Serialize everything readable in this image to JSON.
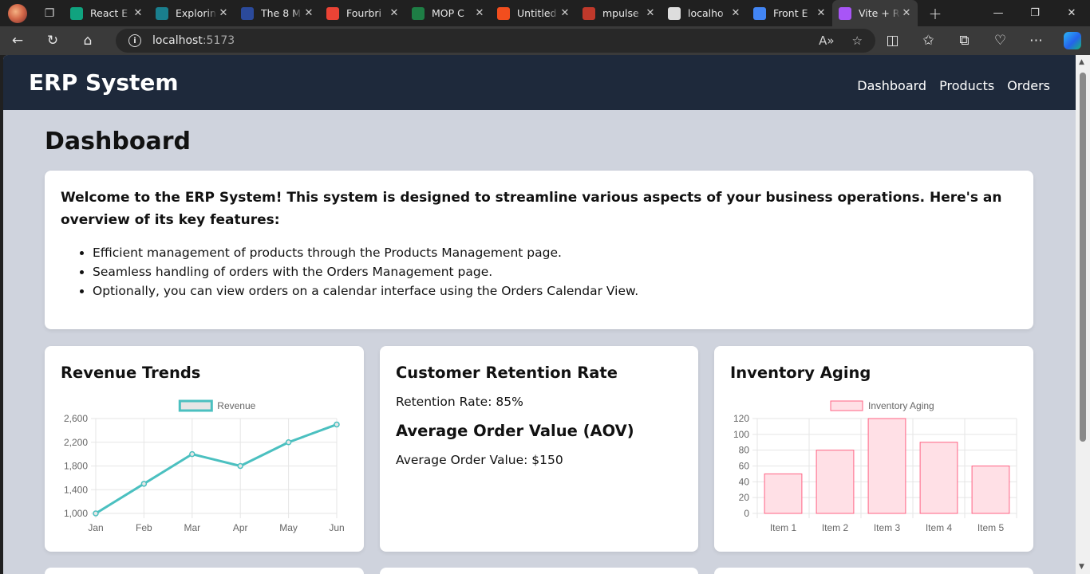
{
  "browser": {
    "tabs": [
      {
        "label": "React E",
        "color": "#10a37f"
      },
      {
        "label": "Explorin",
        "color": "#1a7f8e"
      },
      {
        "label": "The 8 M",
        "color": "#2b4a9b"
      },
      {
        "label": "Fourbri",
        "color": "#ea4335"
      },
      {
        "label": "MOP C",
        "color": "#1e7e45"
      },
      {
        "label": "Untitled",
        "color": "#f24e1e"
      },
      {
        "label": "mpulse",
        "color": "#c0392b"
      },
      {
        "label": "localho",
        "color": "#dddddd"
      },
      {
        "label": "Front E",
        "color": "#4285f4"
      },
      {
        "label": "Vite + R",
        "color": "#a855f7"
      }
    ],
    "address": {
      "host": "localhost",
      "port": ":5173"
    }
  },
  "app": {
    "brand": "ERP System",
    "nav": [
      "Dashboard",
      "Products",
      "Orders"
    ],
    "page_title": "Dashboard",
    "welcome": {
      "intro": "Welcome to the ERP System! This system is designed to streamline various aspects of your business operations. Here's an overview of its key features:",
      "features": [
        "Efficient management of products through the Products Management page.",
        "Seamless handling of orders with the Orders Management page.",
        "Optionally, you can view orders on a calendar interface using the Orders Calendar View."
      ]
    },
    "cards": {
      "revenue": {
        "title": "Revenue Trends"
      },
      "retention": {
        "title": "Customer Retention Rate",
        "retention_text": "Retention Rate: 85%",
        "aov_title": "Average Order Value (AOV)",
        "aov_text": "Average Order Value: $150"
      },
      "inventory": {
        "title": "Inventory Aging"
      }
    }
  },
  "chart_data": [
    {
      "type": "line",
      "legend": "Revenue",
      "categories": [
        "Jan",
        "Feb",
        "Mar",
        "Apr",
        "May",
        "Jun"
      ],
      "series": [
        {
          "name": "Revenue",
          "values": [
            1000,
            1500,
            2000,
            1800,
            2200,
            2500
          ]
        }
      ],
      "ylim": [
        1000,
        2600
      ],
      "yticks": [
        1000,
        1400,
        1800,
        2200,
        2600
      ],
      "ytick_labels": [
        "1,000",
        "1,400",
        "1,800",
        "2,200",
        "2,600"
      ],
      "color": "#4bc0c0",
      "fill": "#e6e6e6"
    },
    {
      "type": "bar",
      "legend": "Inventory Aging",
      "categories": [
        "Item 1",
        "Item 2",
        "Item 3",
        "Item 4",
        "Item 5"
      ],
      "series": [
        {
          "name": "Inventory Aging",
          "values": [
            50,
            80,
            120,
            90,
            60
          ]
        }
      ],
      "ylim": [
        0,
        120
      ],
      "yticks": [
        0,
        20,
        40,
        60,
        80,
        100,
        120
      ],
      "ytick_labels": [
        "0",
        "20",
        "40",
        "60",
        "80",
        "100",
        "120"
      ],
      "color": "#ff6384",
      "fill": "#ffe0e6"
    }
  ]
}
